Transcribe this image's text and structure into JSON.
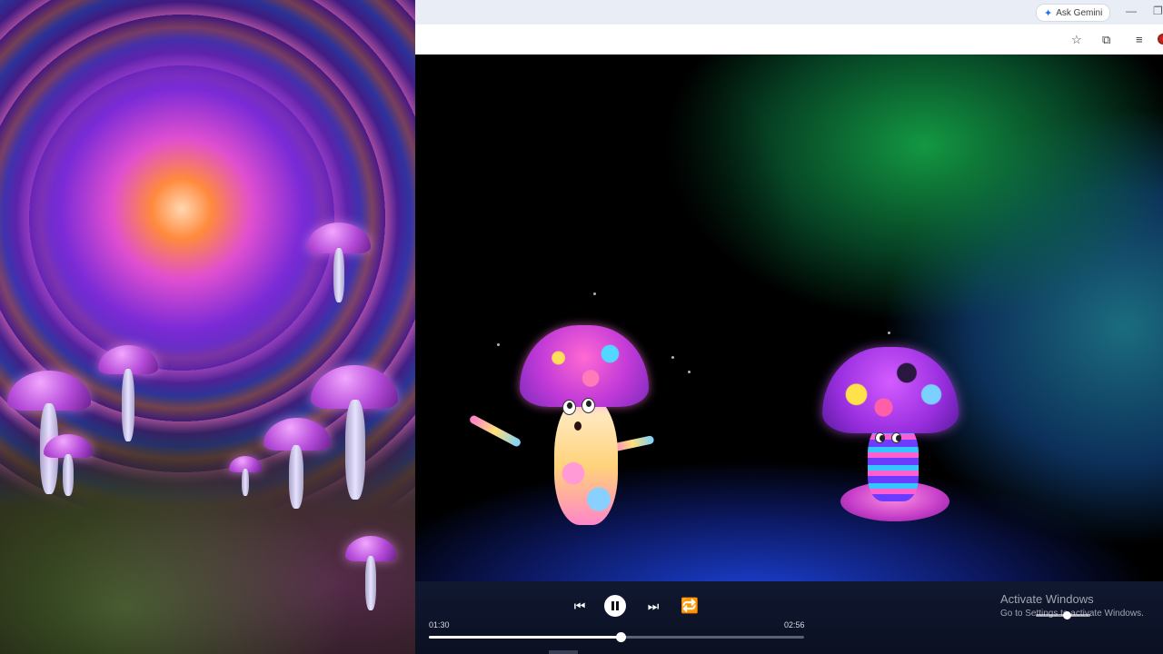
{
  "browser": {
    "gemini_button": "Ask Gemini",
    "icons": [
      "star-icon",
      "extensions-icon",
      "media-controls-icon",
      "profile-avatar",
      "minimize-icon",
      "restore-icon"
    ]
  },
  "player": {
    "current_time": "01:30",
    "total_time": "02:56",
    "progress": 0.51,
    "state": "playing",
    "loop_color": "#2fd46a"
  },
  "watermark": {
    "line1": "Activate Windows",
    "line2": "Go to Settings to activate Windows."
  },
  "colors": {
    "player_bg": "#0b1022",
    "chrome_bg": "#e9eef6"
  }
}
